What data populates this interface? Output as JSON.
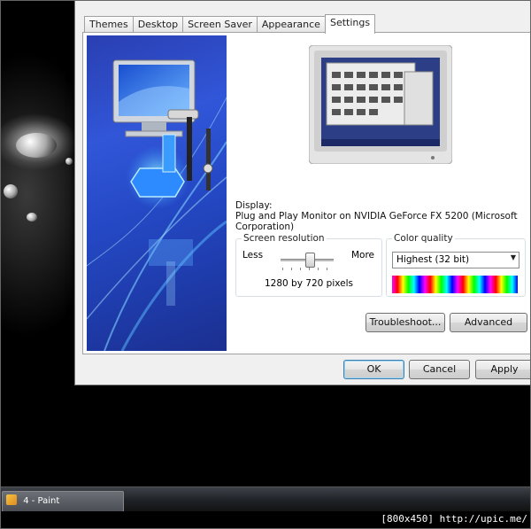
{
  "dialog": {
    "tabs": [
      "Themes",
      "Desktop",
      "Screen Saver",
      "Appearance",
      "Settings"
    ],
    "active_tab": "Settings"
  },
  "display": {
    "label": "Display:",
    "monitor": "Plug and Play Monitor on NVIDIA GeForce FX 5200  (Microsoft Corporation)"
  },
  "resolution": {
    "title": "Screen resolution",
    "less": "Less",
    "more": "More",
    "value_text": "1280 by 720 pixels",
    "slider_position": 0.6
  },
  "color_quality": {
    "title": "Color quality",
    "selected": "Highest (32 bit)"
  },
  "buttons": {
    "troubleshoot": "Troubleshoot...",
    "advanced": "Advanced",
    "ok": "OK",
    "cancel": "Cancel",
    "apply": "Apply"
  },
  "taskbar": {
    "item": "4 - Paint"
  },
  "watermark": "[800x450] http://upic.me/",
  "colors": {
    "accent": "#3156d8",
    "taskbar": "#202328",
    "default_button_border": "#3c7fb1"
  },
  "icons": [
    "paint-icon",
    "dropdown-arrow-icon",
    "monitor-icon"
  ]
}
